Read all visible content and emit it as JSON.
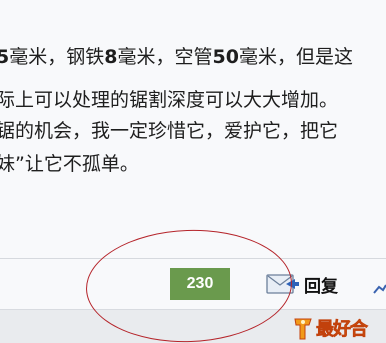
{
  "post": {
    "line1_pre": "5",
    "line1_a": "毫米，钢铁",
    "line1_b": "8",
    "line1_c": "毫米，空管",
    "line1_d": "50",
    "line1_e": "毫米，但是",
    "line1_f": "这",
    "line2": "际上可以处理的锯割深度可以大大增加。",
    "line3": "锯的机会，我一定珍惜它，爱护它，把它",
    "line4": "妹”让它不孤单。"
  },
  "footer": {
    "like_count": "230",
    "reply_label": "回复"
  },
  "watermark": {
    "text": "最好合"
  },
  "colors": {
    "like_bg": "#6a9a4d",
    "annotation": "#b5242a",
    "watermark": "#f19a1a"
  },
  "icons": {
    "reply": "reply-icon",
    "more": "share-icon"
  }
}
